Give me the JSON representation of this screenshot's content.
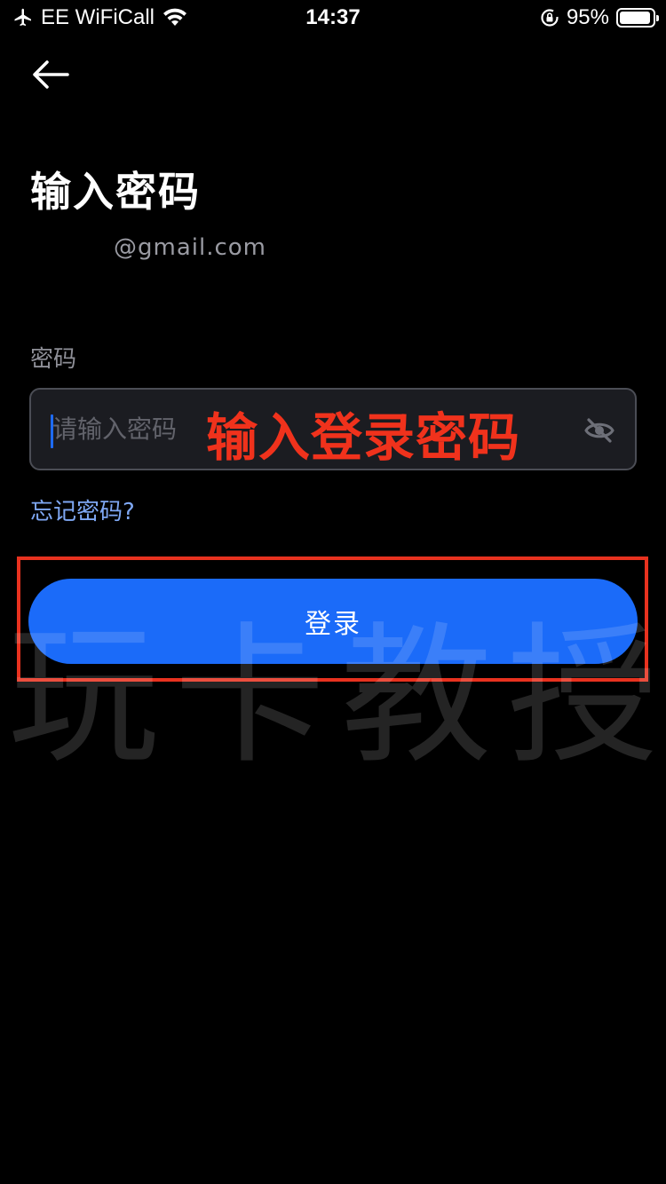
{
  "status_bar": {
    "carrier": "EE WiFiCall",
    "time": "14:37",
    "battery_text": "95%",
    "battery_level": 0.95
  },
  "header": {
    "title": "输入密码",
    "email": "@gmail.com"
  },
  "form": {
    "password_label": "密码",
    "password_placeholder": "请输入密码",
    "password_value": "",
    "forgot_link": "忘记密码?",
    "login_button": "登录"
  },
  "annotations": {
    "caption": "输入登录密码",
    "caption_color": "#f0321c",
    "highlight_color": "#e8321f"
  },
  "watermark": {
    "chars": [
      "玩",
      "卡",
      "教",
      "授"
    ]
  },
  "colors": {
    "background": "#000000",
    "accent": "#1b6bf9",
    "link": "#7fa8f4"
  },
  "icons": {
    "back": "arrow-left-icon",
    "visibility": "eye-off-icon",
    "airplane": "airplane-icon",
    "wifi": "wifi-icon",
    "orientation_lock": "orientation-lock-icon",
    "battery": "battery-icon"
  }
}
